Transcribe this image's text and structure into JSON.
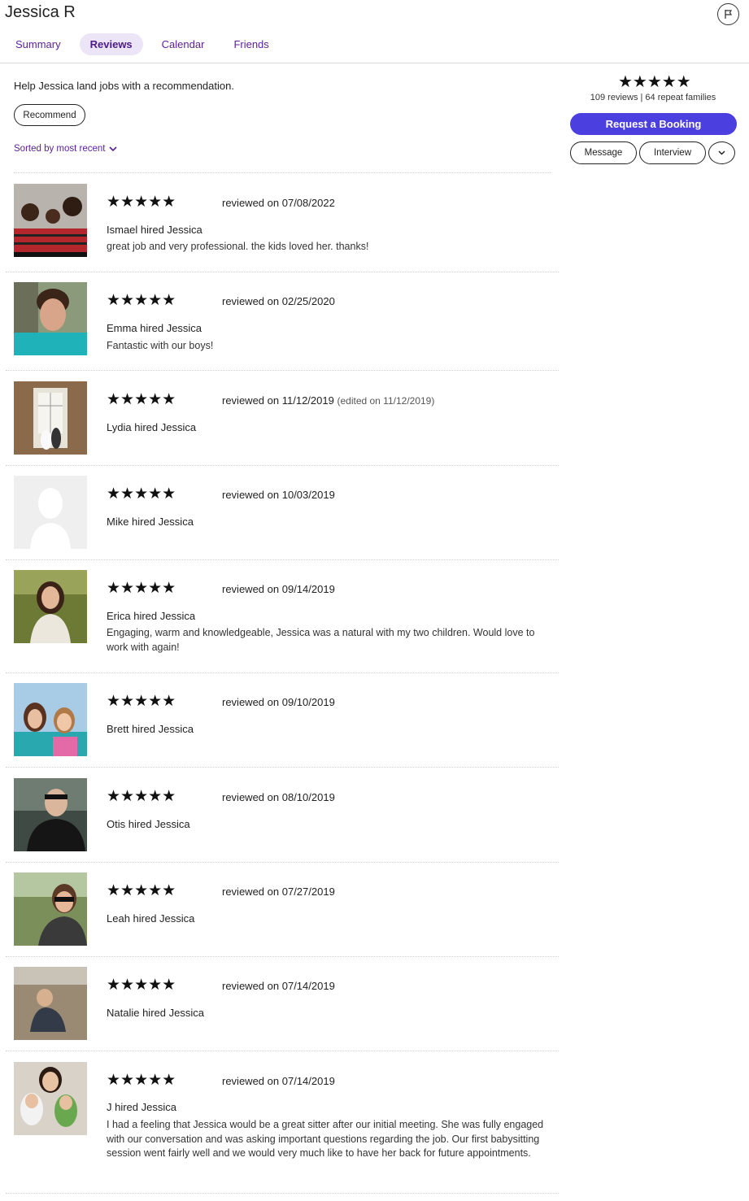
{
  "profile": {
    "name": "Jessica R",
    "tabs": [
      "Summary",
      "Reviews",
      "Calendar",
      "Friends"
    ],
    "active_tab": "Reviews"
  },
  "recommend": {
    "help_text": "Help Jessica land jobs with a recommendation.",
    "button_label": "Recommend",
    "sort_label": "Sorted by most recent"
  },
  "sidebar": {
    "rating_stars": "★★★★★",
    "reviews_meta": "109 reviews | 64 repeat families",
    "request_booking": "Request a Booking",
    "message": "Message",
    "interview": "Interview"
  },
  "colors": {
    "brand_purple": "#5b1f96",
    "booking_button": "#4b3fe0",
    "active_tab_bg": "#ece4f7"
  },
  "reviews": [
    {
      "stars": "★★★★★",
      "date_prefix": "reviewed on",
      "date": "07/08/2022",
      "edited": "",
      "hired": "Ismael hired Jessica",
      "text": "great job and very professional. the kids loved her. thanks!",
      "avatar": "family-photo"
    },
    {
      "stars": "★★★★★",
      "date_prefix": "reviewed on",
      "date": "02/25/2020",
      "edited": "",
      "hired": "Emma hired Jessica",
      "text": "Fantastic with our boys!",
      "avatar": "selfie-photo"
    },
    {
      "stars": "★★★★★",
      "date_prefix": "reviewed on",
      "date": "11/12/2019",
      "edited": "(edited on 11/12/2019)",
      "hired": "Lydia hired Jessica",
      "text": "",
      "avatar": "wedding-photo"
    },
    {
      "stars": "★★★★★",
      "date_prefix": "reviewed on",
      "date": "10/03/2019",
      "edited": "",
      "hired": "Mike hired Jessica",
      "text": "",
      "avatar": "default-placeholder"
    },
    {
      "stars": "★★★★★",
      "date_prefix": "reviewed on",
      "date": "09/14/2019",
      "edited": "",
      "hired": "Erica hired Jessica",
      "text": "Engaging, warm and knowledgeable, Jessica was a natural with my two children. Would love to work with again!",
      "avatar": "portrait-photo"
    },
    {
      "stars": "★★★★★",
      "date_prefix": "reviewed on",
      "date": "09/10/2019",
      "edited": "",
      "hired": "Brett hired Jessica",
      "text": "",
      "avatar": "kids-photo"
    },
    {
      "stars": "★★★★★",
      "date_prefix": "reviewed on",
      "date": "08/10/2019",
      "edited": "",
      "hired": "Otis hired Jessica",
      "text": "",
      "avatar": "man-photo"
    },
    {
      "stars": "★★★★★",
      "date_prefix": "reviewed on",
      "date": "07/27/2019",
      "edited": "",
      "hired": "Leah hired Jessica",
      "text": "",
      "avatar": "mother-baby-photo"
    },
    {
      "stars": "★★★★★",
      "date_prefix": "reviewed on",
      "date": "07/14/2019",
      "edited": "",
      "hired": "Natalie hired Jessica",
      "text": "",
      "avatar": "beach-child-photo"
    },
    {
      "stars": "★★★★★",
      "date_prefix": "reviewed on",
      "date": "07/14/2019",
      "edited": "",
      "hired": "J hired Jessica",
      "text": "I had a feeling that Jessica would be a great sitter after our initial meeting. She was fully engaged with our conversation and was asking important questions regarding the job. Our first babysitting session went fairly well and we would very much like to have her back for future appointments.",
      "avatar": "woman-kids-photo"
    }
  ]
}
